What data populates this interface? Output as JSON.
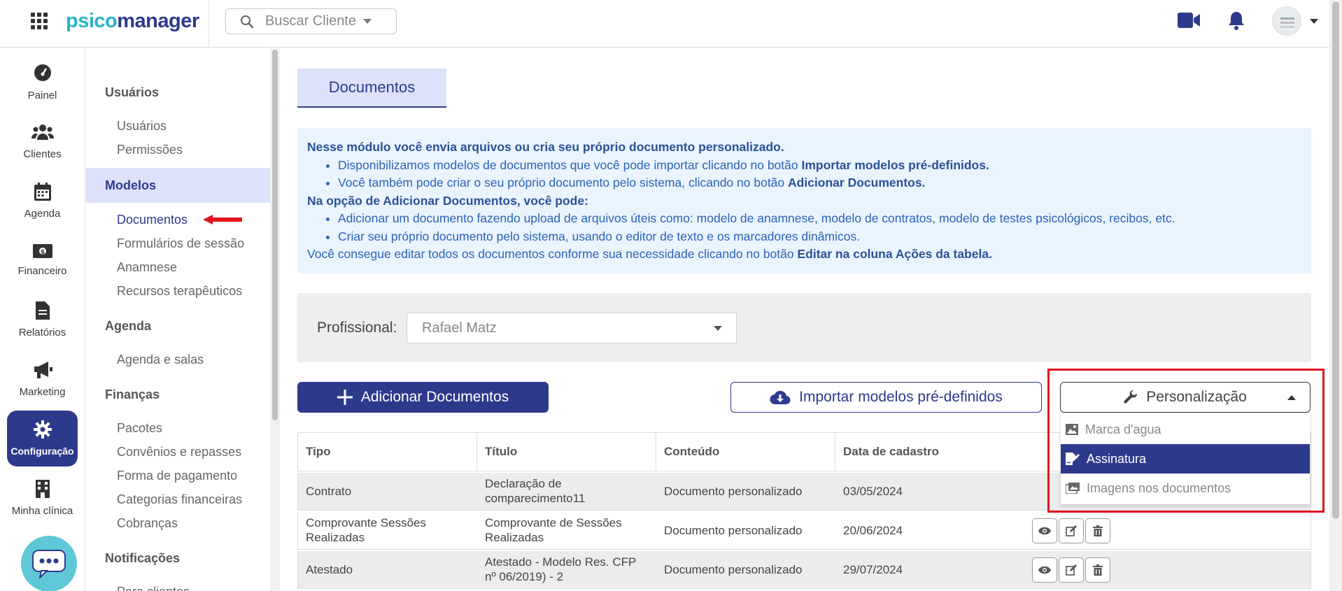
{
  "topbar": {
    "logo_part1": "psico",
    "logo_part2": "manager",
    "search_label": "Buscar Cliente"
  },
  "rail": {
    "items": [
      {
        "label": "Painel",
        "icon": "dashboard-icon"
      },
      {
        "label": "Clientes",
        "icon": "users-icon"
      },
      {
        "label": "Agenda",
        "icon": "calendar-icon"
      },
      {
        "label": "Financeiro",
        "icon": "money-icon"
      },
      {
        "label": "Relatórios",
        "icon": "report-icon"
      },
      {
        "label": "Marketing",
        "icon": "megaphone-icon"
      },
      {
        "label": "Configuração",
        "icon": "gear-icon",
        "active": true
      },
      {
        "label": "Minha clínica",
        "icon": "building-icon"
      }
    ]
  },
  "settings_menu": {
    "usuarios_head": "Usuários",
    "usuarios": "Usuários",
    "permissoes": "Permissões",
    "modelos_head": "Modelos",
    "documentos": "Documentos",
    "formularios": "Formulários de sessão",
    "anamnese": "Anamnese",
    "recursos": "Recursos terapêuticos",
    "agenda_head": "Agenda",
    "agenda_salas": "Agenda e salas",
    "financas_head": "Finanças",
    "pacotes": "Pacotes",
    "convenios": "Convênios e repasses",
    "forma_pagamento": "Forma de pagamento",
    "categorias": "Categorias financeiras",
    "cobrancas": "Cobranças",
    "notificacoes_head": "Notificações",
    "para_clientes": "Para clientes"
  },
  "main": {
    "tab_title": "Documentos",
    "info": {
      "line1": "Nesse módulo você envia arquivos ou cria seu próprio documento personalizado.",
      "bullet1_pre": "Disponibilizamos modelos de documentos que você pode importar clicando no botão ",
      "bullet1_bold": "Importar modelos pré-definidos.",
      "bullet2_pre": "Você também pode criar o seu próprio documento pelo sistema, clicando no botão ",
      "bullet2_bold": "Adicionar Documentos.",
      "line2": "Na opção de Adicionar Documentos, você pode:",
      "bullet3": "Adicionar um documento fazendo upload de arquivos úteis como: modelo de anamnese, modelo de contratos, modelo de testes psicológicos, recibos, etc.",
      "bullet4": "Criar seu próprio documento pelo sistema, usando o editor de texto e os marcadores dinâmicos.",
      "line3_pre": "Você consegue editar todos os documentos conforme sua necessidade clicando no botão ",
      "line3_bold": "Editar na coluna Ações da tabela."
    },
    "filter": {
      "label": "Profissional:",
      "value": "Rafael Matz"
    },
    "buttons": {
      "add": "Adicionar Documentos",
      "import": "Importar modelos pré-definidos",
      "custom": "Personalização"
    },
    "dropdown": {
      "items": [
        "Marca d'agua",
        "Assinatura",
        "Imagens nos documentos"
      ],
      "selected": "Assinatura"
    },
    "table": {
      "headers": [
        "Tipo",
        "Título",
        "Conteúdo",
        "Data de cadastro"
      ],
      "rows": [
        {
          "tipo": "Contrato",
          "titulo": "Declaração de comparecimento11",
          "conteudo": "Documento personalizado",
          "data": "03/05/2024"
        },
        {
          "tipo": "Comprovante Sessões Realizadas",
          "titulo": "Comprovante de Sessões Realizadas",
          "conteudo": "Documento personalizado",
          "data": "20/06/2024"
        },
        {
          "tipo": "Atestado",
          "titulo": "Atestado - Modelo Res. CFP nº 06/2019) - 2",
          "conteudo": "Documento personalizado",
          "data": "29/07/2024"
        }
      ]
    }
  },
  "colors": {
    "brand_primary": "#2d3a8c",
    "brand_secondary": "#27b7c4",
    "highlight": "#e0141e"
  }
}
